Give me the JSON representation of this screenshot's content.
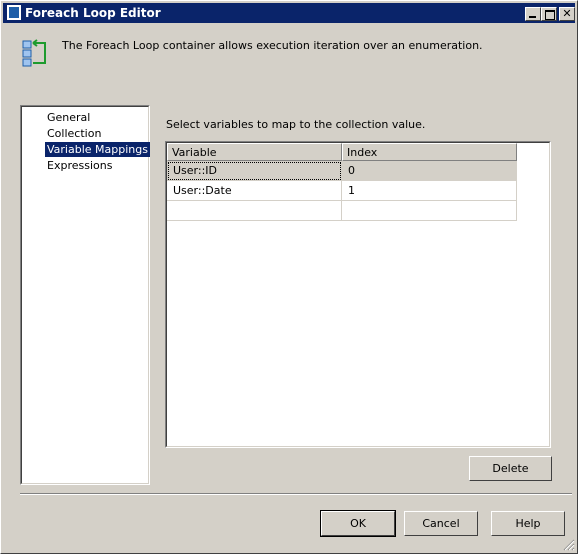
{
  "window": {
    "title": "Foreach Loop Editor"
  },
  "header": {
    "description": "The Foreach Loop container allows execution iteration over an enumeration.",
    "icon": "foreach-loop-icon"
  },
  "nav": {
    "items": [
      {
        "label": "General"
      },
      {
        "label": "Collection"
      },
      {
        "label": "Variable Mappings",
        "selected": true
      },
      {
        "label": "Expressions"
      }
    ]
  },
  "mappings": {
    "instruction": "Select variables to map to the collection value.",
    "columns": [
      "Variable",
      "Index"
    ],
    "rows": [
      {
        "variable": "User::ID",
        "index": "0"
      },
      {
        "variable": "User::Date",
        "index": "1"
      },
      {
        "variable": "",
        "index": ""
      }
    ],
    "delete_label": "Delete"
  },
  "footer": {
    "ok_label": "OK",
    "cancel_label": "Cancel",
    "help_label": "Help"
  },
  "colors": {
    "title_bar": "#0a246a",
    "face": "#d4d0c8",
    "selection": "#0a246a"
  }
}
